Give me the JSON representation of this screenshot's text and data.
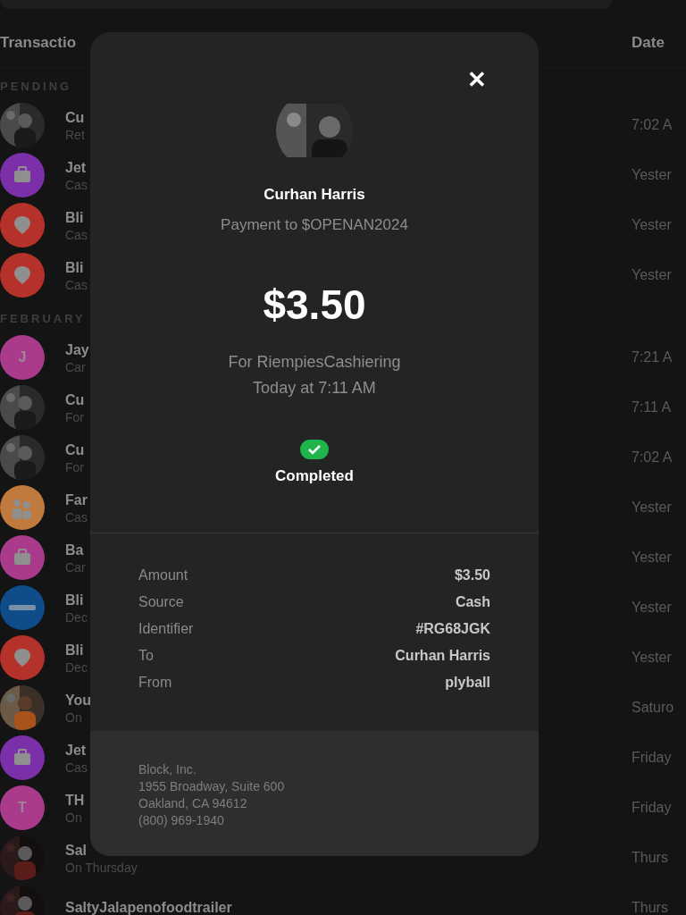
{
  "header": {
    "column_1": "Transactio",
    "column_2": "Date"
  },
  "sections": [
    {
      "title": "PENDING",
      "rows": [
        {
          "name": "Cu",
          "subtitle": "Ret",
          "date": "7:02 A"
        },
        {
          "avatar": {
            "kind": "bag",
            "color": "#7b2fa8"
          },
          "name": "Jet",
          "subtitle": "Cas",
          "date": "Yester"
        },
        {
          "avatar": {
            "kind": "pin",
            "color": "#b5322b"
          },
          "name": "Bli",
          "subtitle": "Cas",
          "date": "Yester"
        },
        {
          "avatar": {
            "kind": "pin",
            "color": "#b5322b"
          },
          "name": "Bli",
          "subtitle": "Cas",
          "date": "Yester"
        }
      ]
    },
    {
      "title": "FEBRUARY",
      "rows": [
        {
          "avatar": {
            "kind": "initial",
            "color": "#a93a8c",
            "letter": "J"
          },
          "name": "Jay",
          "subtitle": "Car",
          "date": "7:21 A"
        },
        {
          "name": "Cu",
          "subtitle": "For",
          "date": "7:11 A"
        },
        {
          "name": "Cu",
          "subtitle": "For",
          "date": "7:02 A"
        },
        {
          "avatar": {
            "kind": "group",
            "color": "#c07a3e"
          },
          "name": "Far",
          "subtitle": "Cas",
          "date": "Yester"
        },
        {
          "avatar": {
            "kind": "bag",
            "color": "#a93a8c"
          },
          "name": "Ba",
          "subtitle": "Car",
          "date": "Yester"
        },
        {
          "avatar": {
            "kind": "logo",
            "color": "#0f4c8a"
          },
          "name": "Bli",
          "subtitle": "Dec",
          "date": "Yester"
        },
        {
          "avatar": {
            "kind": "pin",
            "color": "#b5322b"
          },
          "name": "Bli",
          "subtitle": "Dec",
          "date": "Yester"
        },
        {
          "avatar": {
            "kind": "person"
          },
          "name": "You",
          "subtitle": "On",
          "date": "Saturo"
        },
        {
          "avatar": {
            "kind": "bag",
            "color": "#7b2fa8"
          },
          "name": "Jet",
          "subtitle": "Cas",
          "date": "Friday"
        },
        {
          "avatar": {
            "kind": "initial",
            "color": "#a93a8c",
            "letter": "T"
          },
          "name": "TH",
          "subtitle": "On",
          "date": "Friday"
        },
        {
          "avatar": {
            "kind": "dark"
          },
          "name": "Sal",
          "subtitle": "On Thursday",
          "date": "Thurs"
        },
        {
          "avatar": {
            "kind": "dark"
          },
          "name": "SaltyJalapenofoodtrailer",
          "subtitle": "",
          "date": "Thurs"
        }
      ]
    }
  ],
  "modal": {
    "close": "✕",
    "name": "Curhan Harris",
    "payment_to": "Payment to $OPENAN2024",
    "amount": "$3.50",
    "note": "For RiempiesCashiering",
    "time": "Today at 7:11 AM",
    "status": "Completed",
    "details": [
      {
        "label": "Amount",
        "value": "$3.50"
      },
      {
        "label": "Source",
        "value": "Cash"
      },
      {
        "label": "Identifier",
        "value": "#RG68JGK"
      },
      {
        "label": "To",
        "value": "Curhan Harris"
      },
      {
        "label": "From",
        "value": "plyball"
      }
    ],
    "footer": [
      "Block, Inc.",
      "1955 Broadway, Suite 600",
      "Oakland, CA 94612",
      "(800) 969-1940"
    ]
  }
}
